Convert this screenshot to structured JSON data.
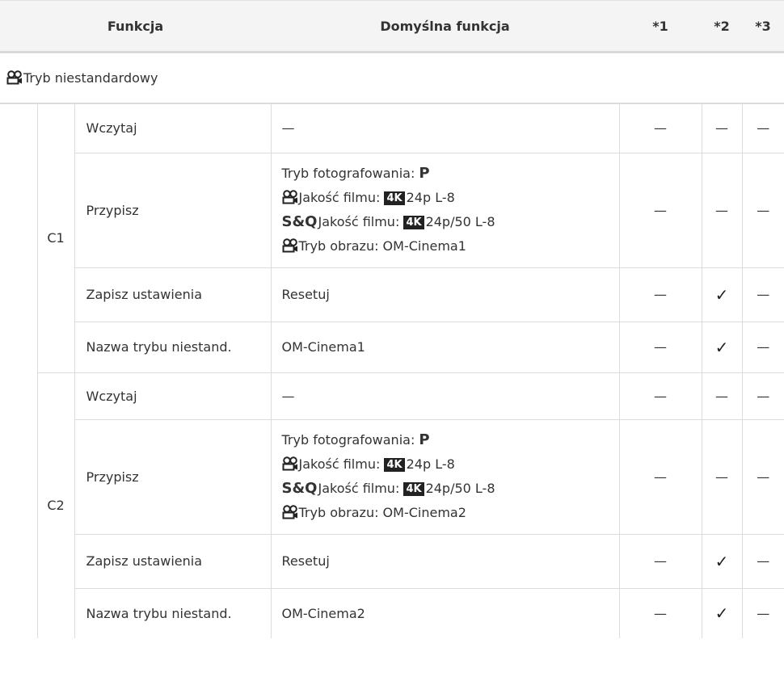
{
  "header": {
    "funkcja": "Funkcja",
    "domyslna": "Domyślna funkcja",
    "c1": "*1",
    "c2": "*2",
    "c3": "*3"
  },
  "section_label": "Tryb niestandardowy",
  "dash": "—",
  "check": "✓",
  "groups": [
    {
      "label": "C1",
      "wczytaj": "Wczytaj",
      "przypisz": "Przypisz",
      "przypisz_lines": {
        "tryb_fot": "Tryb fotografowania:",
        "p": "P",
        "jakosc": "Jakość filmu:",
        "k4": "4K",
        "movie_val": "24p L-8",
        "sq_label": "S&Q",
        "sq_val": "24p/50 L-8",
        "tryb_obrazu": "Tryb obrazu: OM-Cinema1"
      },
      "zapisz": "Zapisz ustawienia",
      "zapisz_def": "Resetuj",
      "nazwa": "Nazwa trybu niestand.",
      "nazwa_def": "OM-Cinema1"
    },
    {
      "label": "C2",
      "wczytaj": "Wczytaj",
      "przypisz": "Przypisz",
      "przypisz_lines": {
        "tryb_fot": "Tryb fotografowania:",
        "p": "P",
        "jakosc": "Jakość filmu:",
        "k4": "4K",
        "movie_val": "24p L-8",
        "sq_label": "S&Q",
        "sq_val": "24p/50 L-8",
        "tryb_obrazu": "Tryb obrazu: OM-Cinema2"
      },
      "zapisz": "Zapisz ustawienia",
      "zapisz_def": "Resetuj",
      "nazwa": "Nazwa trybu niestand.",
      "nazwa_def": "OM-Cinema2"
    }
  ]
}
